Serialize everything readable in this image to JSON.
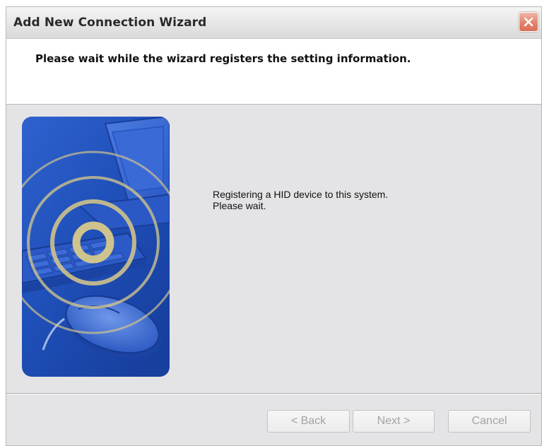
{
  "window": {
    "title": "Add New Connection Wizard"
  },
  "header": {
    "title": "Please wait while the wizard registers the setting information."
  },
  "content": {
    "message_line1": "Registering a HID device to this system.",
    "message_line2": "Please wait.",
    "image": {
      "description_icon": "wireless-keyboard-mouse-illustration"
    }
  },
  "buttons": {
    "back_label": "< Back",
    "next_label": "Next >",
    "cancel_label": "Cancel",
    "back_enabled": false,
    "next_enabled": false,
    "cancel_enabled": false
  },
  "colors": {
    "illustration_blue": "#1f4fb8",
    "ring_color": "#d8c98a",
    "close_red": "#dc6d57",
    "disabled_text": "#a3a3a3"
  }
}
